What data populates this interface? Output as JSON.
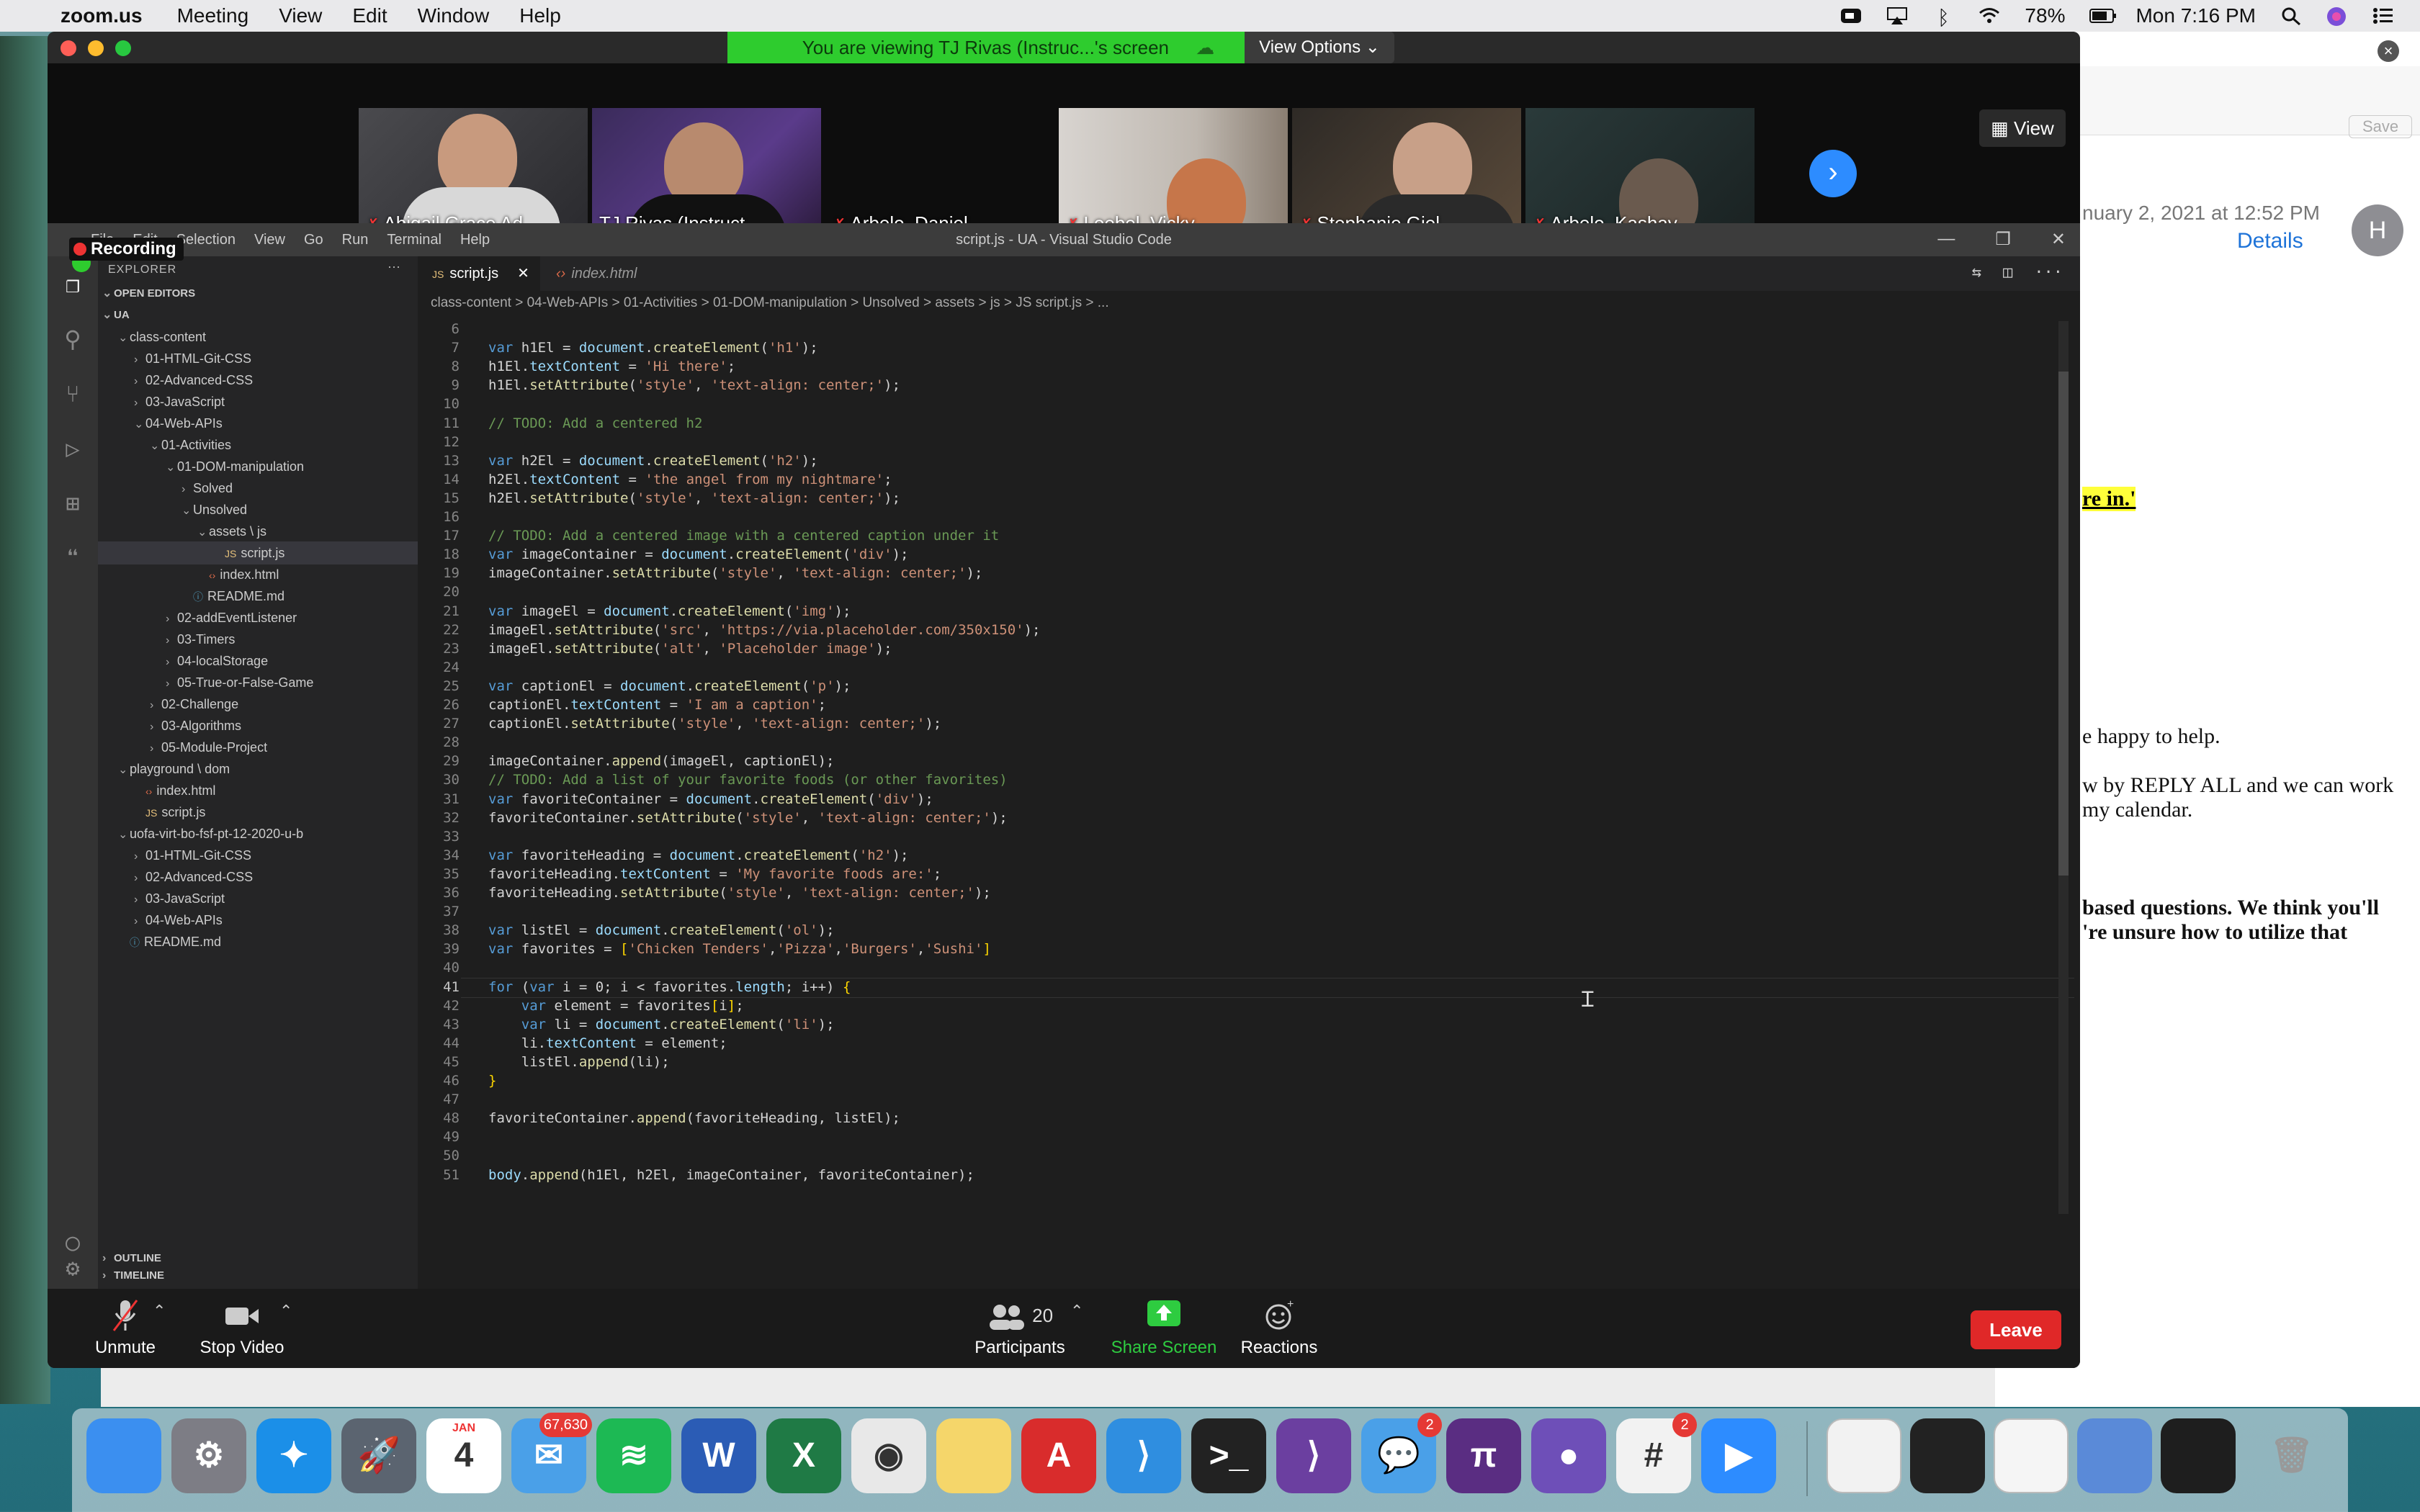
{
  "menubar": {
    "app": "zoom.us",
    "items": [
      "Meeting",
      "View",
      "Edit",
      "Window",
      "Help"
    ],
    "battery": "78%",
    "clock": "Mon 7:16 PM"
  },
  "mail": {
    "date": "nuary 2, 2021 at 12:52 PM",
    "details": "Details",
    "avatar": "H",
    "save": "Save",
    "highlight": "re in.'",
    "line1": "e happy to help.",
    "line2": "w by REPLY ALL and we can work",
    "line3": "my calendar.",
    "line4": "based questions. We think you'll",
    "line5": "'re unsure how to utilize that"
  },
  "zoom": {
    "banner": "You are viewing TJ Rivas (Instruc...'s screen",
    "view_options": "View Options",
    "view_button": "View",
    "participants": [
      {
        "name": "Abigail Grace Ad...",
        "muted": true
      },
      {
        "name": "TJ Rivas (Instruct...",
        "muted": false,
        "active": true
      },
      {
        "name": "Arbelo, Daniel",
        "muted": true
      },
      {
        "name": "Loebel, Vicky",
        "muted": true
      },
      {
        "name": "Stephanie Giel",
        "muted": true
      },
      {
        "name": "Arbelo, Kashay",
        "muted": true
      }
    ],
    "controls": {
      "unmute": "Unmute",
      "stop_video": "Stop Video",
      "participants": "Participants",
      "participants_count": "20",
      "share": "Share Screen",
      "reactions": "Reactions",
      "leave": "Leave"
    },
    "recording": "Recording"
  },
  "vscode": {
    "title": "script.js - UA - Visual Studio Code",
    "menu": [
      "File",
      "Edit",
      "Selection",
      "View",
      "Go",
      "Run",
      "Terminal",
      "Help"
    ],
    "explorer": "EXPLORER",
    "tabs": [
      "script.js",
      "index.html"
    ],
    "breadcrumb": "class-content  >  04-Web-APIs  >  01-Activities  >  01-DOM-manipulation  >  Unsolved  >  assets  >  js  >  JS script.js  >  ...",
    "tree": [
      {
        "t": "OPEN EDITORS",
        "d": 0,
        "k": "hdr"
      },
      {
        "t": "UA",
        "d": 0,
        "k": "hdr"
      },
      {
        "t": "class-content",
        "d": 1,
        "k": "open"
      },
      {
        "t": "01-HTML-Git-CSS",
        "d": 2,
        "k": "dir"
      },
      {
        "t": "02-Advanced-CSS",
        "d": 2,
        "k": "dir"
      },
      {
        "t": "03-JavaScript",
        "d": 2,
        "k": "dir"
      },
      {
        "t": "04-Web-APIs",
        "d": 2,
        "k": "open"
      },
      {
        "t": "01-Activities",
        "d": 3,
        "k": "open"
      },
      {
        "t": "01-DOM-manipulation",
        "d": 4,
        "k": "open"
      },
      {
        "t": "Solved",
        "d": 5,
        "k": "dir"
      },
      {
        "t": "Unsolved",
        "d": 5,
        "k": "open"
      },
      {
        "t": "assets \\ js",
        "d": 6,
        "k": "open"
      },
      {
        "t": "script.js",
        "d": 7,
        "k": "js",
        "sel": true
      },
      {
        "t": "index.html",
        "d": 6,
        "k": "html"
      },
      {
        "t": "README.md",
        "d": 5,
        "k": "md"
      },
      {
        "t": "02-addEventListener",
        "d": 4,
        "k": "dir"
      },
      {
        "t": "03-Timers",
        "d": 4,
        "k": "dir"
      },
      {
        "t": "04-localStorage",
        "d": 4,
        "k": "dir"
      },
      {
        "t": "05-True-or-False-Game",
        "d": 4,
        "k": "dir"
      },
      {
        "t": "02-Challenge",
        "d": 3,
        "k": "dir"
      },
      {
        "t": "03-Algorithms",
        "d": 3,
        "k": "dir"
      },
      {
        "t": "05-Module-Project",
        "d": 3,
        "k": "dir"
      },
      {
        "t": "playground \\ dom",
        "d": 1,
        "k": "open"
      },
      {
        "t": "index.html",
        "d": 2,
        "k": "html"
      },
      {
        "t": "script.js",
        "d": 2,
        "k": "js"
      },
      {
        "t": "uofa-virt-bo-fsf-pt-12-2020-u-b",
        "d": 1,
        "k": "open"
      },
      {
        "t": "01-HTML-Git-CSS",
        "d": 2,
        "k": "dir"
      },
      {
        "t": "02-Advanced-CSS",
        "d": 2,
        "k": "dir"
      },
      {
        "t": "03-JavaScript",
        "d": 2,
        "k": "dir"
      },
      {
        "t": "04-Web-APIs",
        "d": 2,
        "k": "dir"
      },
      {
        "t": "README.md",
        "d": 1,
        "k": "md"
      }
    ],
    "outline": "OUTLINE",
    "timeline": "TIMELINE",
    "code": [
      {
        "n": "6",
        "s": ""
      },
      {
        "n": "7",
        "s": "var h1El = document.createElement('h1');"
      },
      {
        "n": "8",
        "s": "h1El.textContent = 'Hi there';"
      },
      {
        "n": "9",
        "s": "h1El.setAttribute('style', 'text-align: center;');"
      },
      {
        "n": "10",
        "s": ""
      },
      {
        "n": "11",
        "s": "// TODO: Add a centered h2"
      },
      {
        "n": "12",
        "s": ""
      },
      {
        "n": "13",
        "s": "var h2El = document.createElement('h2');"
      },
      {
        "n": "14",
        "s": "h2El.textContent = 'the angel from my nightmare';"
      },
      {
        "n": "15",
        "s": "h2El.setAttribute('style', 'text-align: center;');"
      },
      {
        "n": "16",
        "s": ""
      },
      {
        "n": "17",
        "s": "// TODO: Add a centered image with a centered caption under it"
      },
      {
        "n": "18",
        "s": "var imageContainer = document.createElement('div');"
      },
      {
        "n": "19",
        "s": "imageContainer.setAttribute('style', 'text-align: center;');"
      },
      {
        "n": "20",
        "s": ""
      },
      {
        "n": "21",
        "s": "var imageEl = document.createElement('img');"
      },
      {
        "n": "22",
        "s": "imageEl.setAttribute('src', 'https://via.placeholder.com/350x150');"
      },
      {
        "n": "23",
        "s": "imageEl.setAttribute('alt', 'Placeholder image');"
      },
      {
        "n": "24",
        "s": ""
      },
      {
        "n": "25",
        "s": "var captionEl = document.createElement('p');"
      },
      {
        "n": "26",
        "s": "captionEl.textContent = 'I am a caption';"
      },
      {
        "n": "27",
        "s": "captionEl.setAttribute('style', 'text-align: center;');"
      },
      {
        "n": "28",
        "s": ""
      },
      {
        "n": "29",
        "s": "imageContainer.append(imageEl, captionEl);"
      },
      {
        "n": "30",
        "s": "// TODO: Add a list of your favorite foods (or other favorites)"
      },
      {
        "n": "31",
        "s": "var favoriteContainer = document.createElement('div');"
      },
      {
        "n": "32",
        "s": "favoriteContainer.setAttribute('style', 'text-align: center;');"
      },
      {
        "n": "33",
        "s": ""
      },
      {
        "n": "34",
        "s": "var favoriteHeading = document.createElement('h2');"
      },
      {
        "n": "35",
        "s": "favoriteHeading.textContent = 'My favorite foods are:';"
      },
      {
        "n": "36",
        "s": "favoriteHeading.setAttribute('style', 'text-align: center;');"
      },
      {
        "n": "37",
        "s": ""
      },
      {
        "n": "38",
        "s": "var listEl = document.createElement('ol');"
      },
      {
        "n": "39",
        "s": "var favorites = ['Chicken Tenders','Pizza','Burgers','Sushi']"
      },
      {
        "n": "40",
        "s": ""
      },
      {
        "n": "41",
        "s": "for (var i = 0; i < favorites.length; i++) {"
      },
      {
        "n": "42",
        "s": "    var element = favorites[i];"
      },
      {
        "n": "43",
        "s": "    var li = document.createElement('li');"
      },
      {
        "n": "44",
        "s": "    li.textContent = element;"
      },
      {
        "n": "45",
        "s": "    listEl.append(li);"
      },
      {
        "n": "46",
        "s": "}"
      },
      {
        "n": "47",
        "s": ""
      },
      {
        "n": "48",
        "s": "favoriteContainer.append(favoriteHeading, listEl);"
      },
      {
        "n": "49",
        "s": ""
      },
      {
        "n": "50",
        "s": ""
      },
      {
        "n": "51",
        "s": "body.append(h1El, h2El, imageContainer, favoriteContainer);"
      }
    ],
    "current_line": "41"
  },
  "dock": {
    "apps": [
      {
        "name": "Finder",
        "label": "",
        "color": "#3b8ff0"
      },
      {
        "name": "System Preferences",
        "label": "⚙",
        "color": "#7d7d85"
      },
      {
        "name": "Safari",
        "label": "✦",
        "color": "#1b8fe8"
      },
      {
        "name": "Launchpad",
        "label": "🚀",
        "color": "#5b6470"
      },
      {
        "name": "Calendar",
        "label": "4",
        "month": "JAN",
        "color": "#ffffff"
      },
      {
        "name": "Mail",
        "label": "✉",
        "color": "#4aa0e8",
        "badge": "67,630"
      },
      {
        "name": "Spotify",
        "label": "≋",
        "color": "#1db954"
      },
      {
        "name": "Word",
        "label": "W",
        "color": "#2b5cb5"
      },
      {
        "name": "Excel",
        "label": "X",
        "color": "#1f7a45"
      },
      {
        "name": "Chrome",
        "label": "◉",
        "color": "#e8e8e8"
      },
      {
        "name": "Notes",
        "label": "",
        "color": "#f5d66a"
      },
      {
        "name": "Acrobat",
        "label": "A",
        "color": "#d92c2c"
      },
      {
        "name": "VS Code",
        "label": "⟩",
        "color": "#2f8ee0"
      },
      {
        "name": "Terminal",
        "label": ">_",
        "color": "#222"
      },
      {
        "name": "Visual Studio",
        "label": "⟩",
        "color": "#6b3fa0"
      },
      {
        "name": "Messages",
        "label": "💬",
        "color": "#4aa0e8",
        "badge": "2"
      },
      {
        "name": "Pi",
        "label": "π",
        "color": "#5a2d82"
      },
      {
        "name": "GitHub",
        "label": "●",
        "color": "#6e4fb8"
      },
      {
        "name": "Slack",
        "label": "#",
        "color": "#f2f2f2",
        "badge": "2"
      },
      {
        "name": "Zoom",
        "label": "▶",
        "color": "#2d8cff"
      }
    ]
  }
}
